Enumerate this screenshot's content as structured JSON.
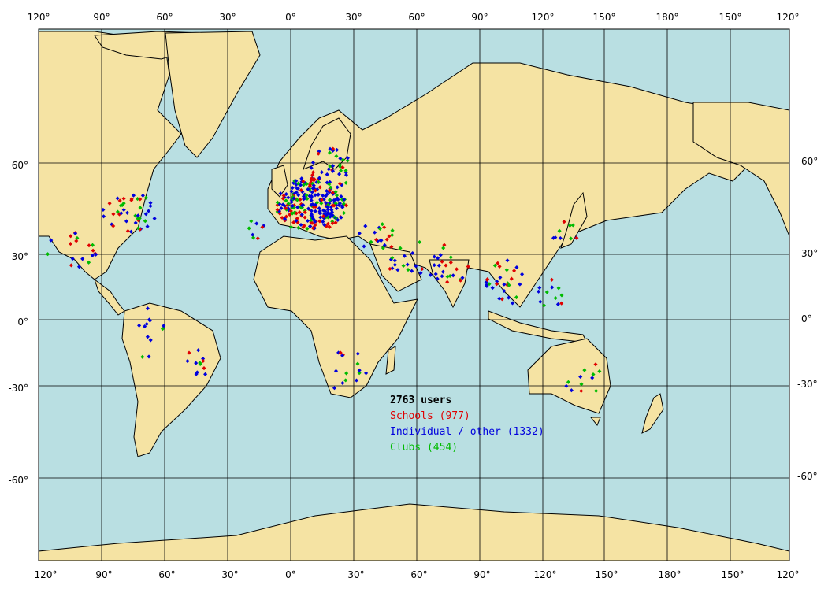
{
  "map": {
    "colors": {
      "ocean": "#b9dfe2",
      "land": "#f5e3a3",
      "grid": "#000000",
      "schools": "#e00000",
      "individual": "#0000dd",
      "clubs": "#00bb00"
    },
    "lon_labels": [
      "120°",
      "90°",
      "60°",
      "30°",
      "0°",
      "30°",
      "60°",
      "90°",
      "120°",
      "150°",
      "180°",
      "150°",
      "120°"
    ],
    "lat_labels": [
      "60°",
      "30°",
      "0°",
      "-30°",
      "-60°"
    ]
  },
  "legend": {
    "total": "2763 users",
    "schools": "Schools (977)",
    "individual": "Individual / other (1332)",
    "clubs": "Clubs (454)"
  }
}
